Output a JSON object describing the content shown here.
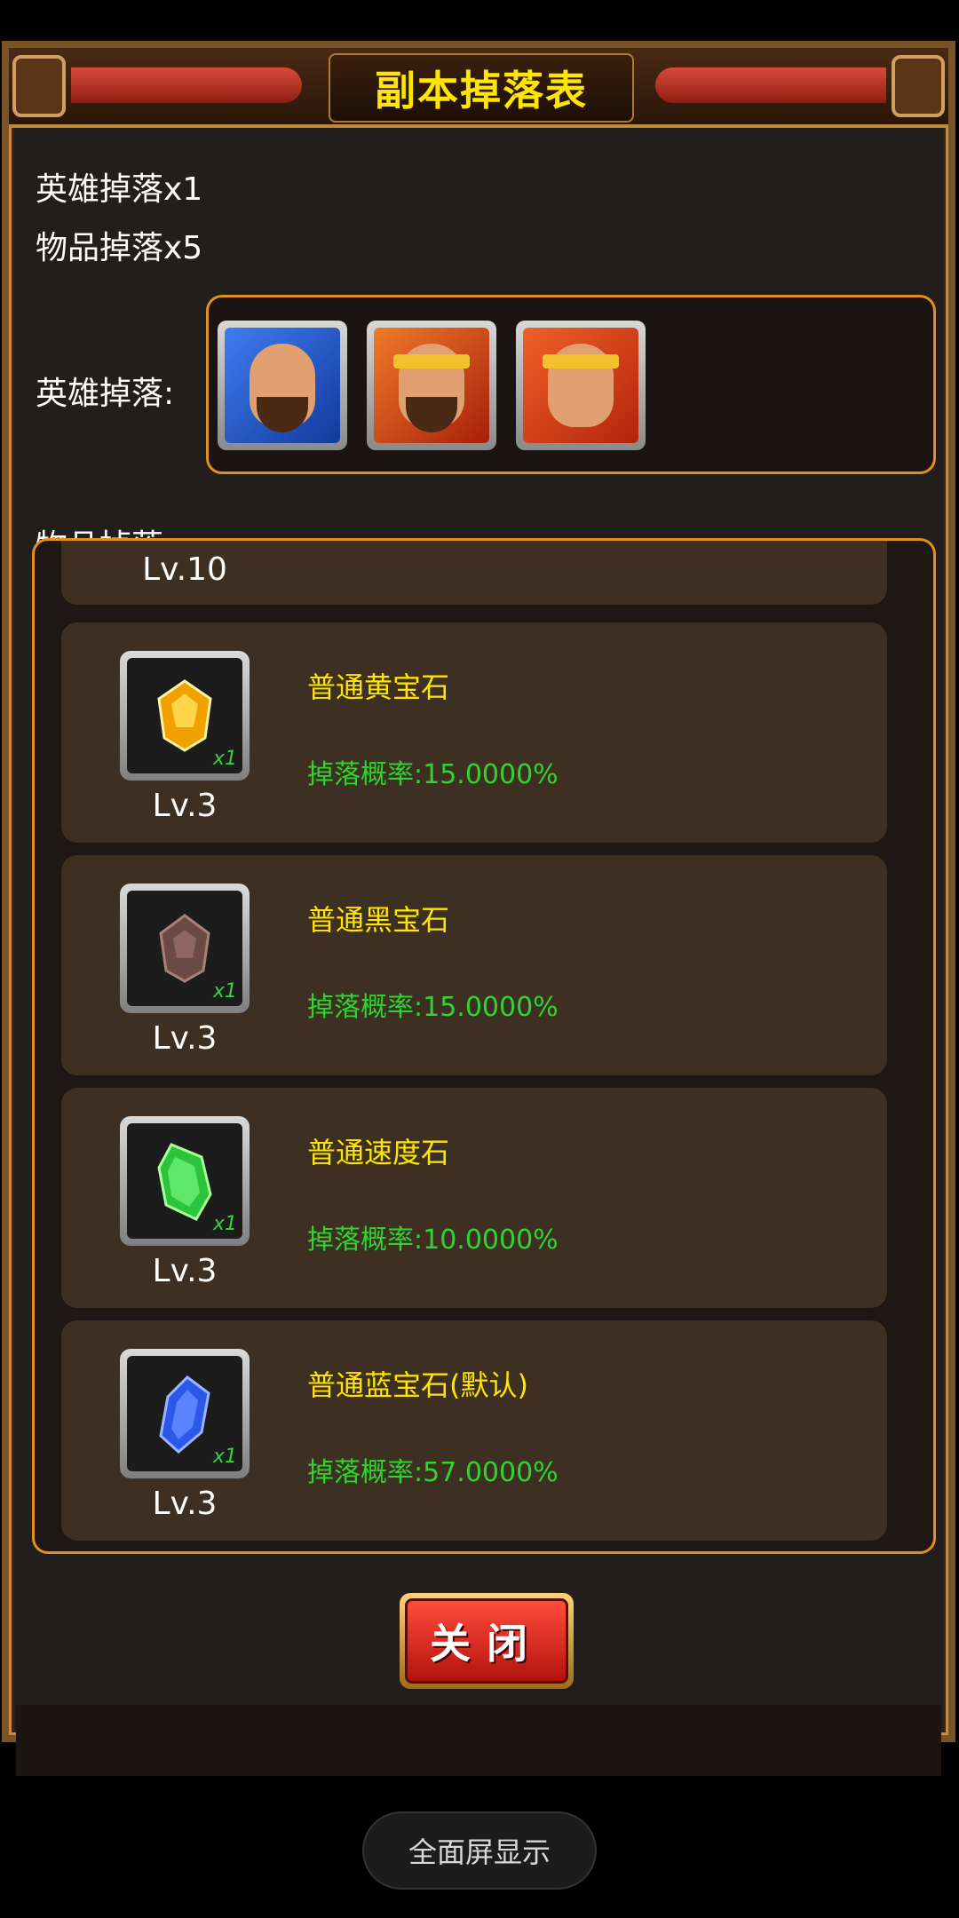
{
  "dialog": {
    "title": "副本掉落表",
    "hero_drop_count": "英雄掉落x1",
    "item_drop_count": "物品掉落x5",
    "hero_drop_label": "英雄掉落:",
    "item_drop_label": "物品掉落:",
    "heroes": [
      {
        "name": "hero-portrait-1",
        "bg": "#2a5fd6"
      },
      {
        "name": "hero-portrait-2",
        "bg": "#d24a1a"
      },
      {
        "name": "hero-portrait-3",
        "bg": "#d84a18"
      }
    ],
    "items": [
      {
        "level": "Lv.10",
        "partial": true
      },
      {
        "name": "普通黄宝石",
        "rate": "掉落概率:15.0000%",
        "level": "Lv.3",
        "qty": "x1",
        "gem_color": "#f0a100",
        "gem_icon": "yellow-gem-icon"
      },
      {
        "name": "普通黑宝石",
        "rate": "掉落概率:15.0000%",
        "level": "Lv.3",
        "qty": "x1",
        "gem_color": "#6b4944",
        "gem_icon": "black-gem-icon"
      },
      {
        "name": "普通速度石",
        "rate": "掉落概率:10.0000%",
        "level": "Lv.3",
        "qty": "x1",
        "gem_color": "#2bc43b",
        "gem_icon": "speed-gem-icon"
      },
      {
        "name": "普通蓝宝石(默认)",
        "rate": "掉落概率:57.0000%",
        "level": "Lv.3",
        "qty": "x1",
        "gem_color": "#2b58e8",
        "gem_icon": "blue-gem-icon"
      }
    ],
    "close_label": "关闭"
  },
  "system": {
    "fullscreen_label": "全面屏显示"
  }
}
